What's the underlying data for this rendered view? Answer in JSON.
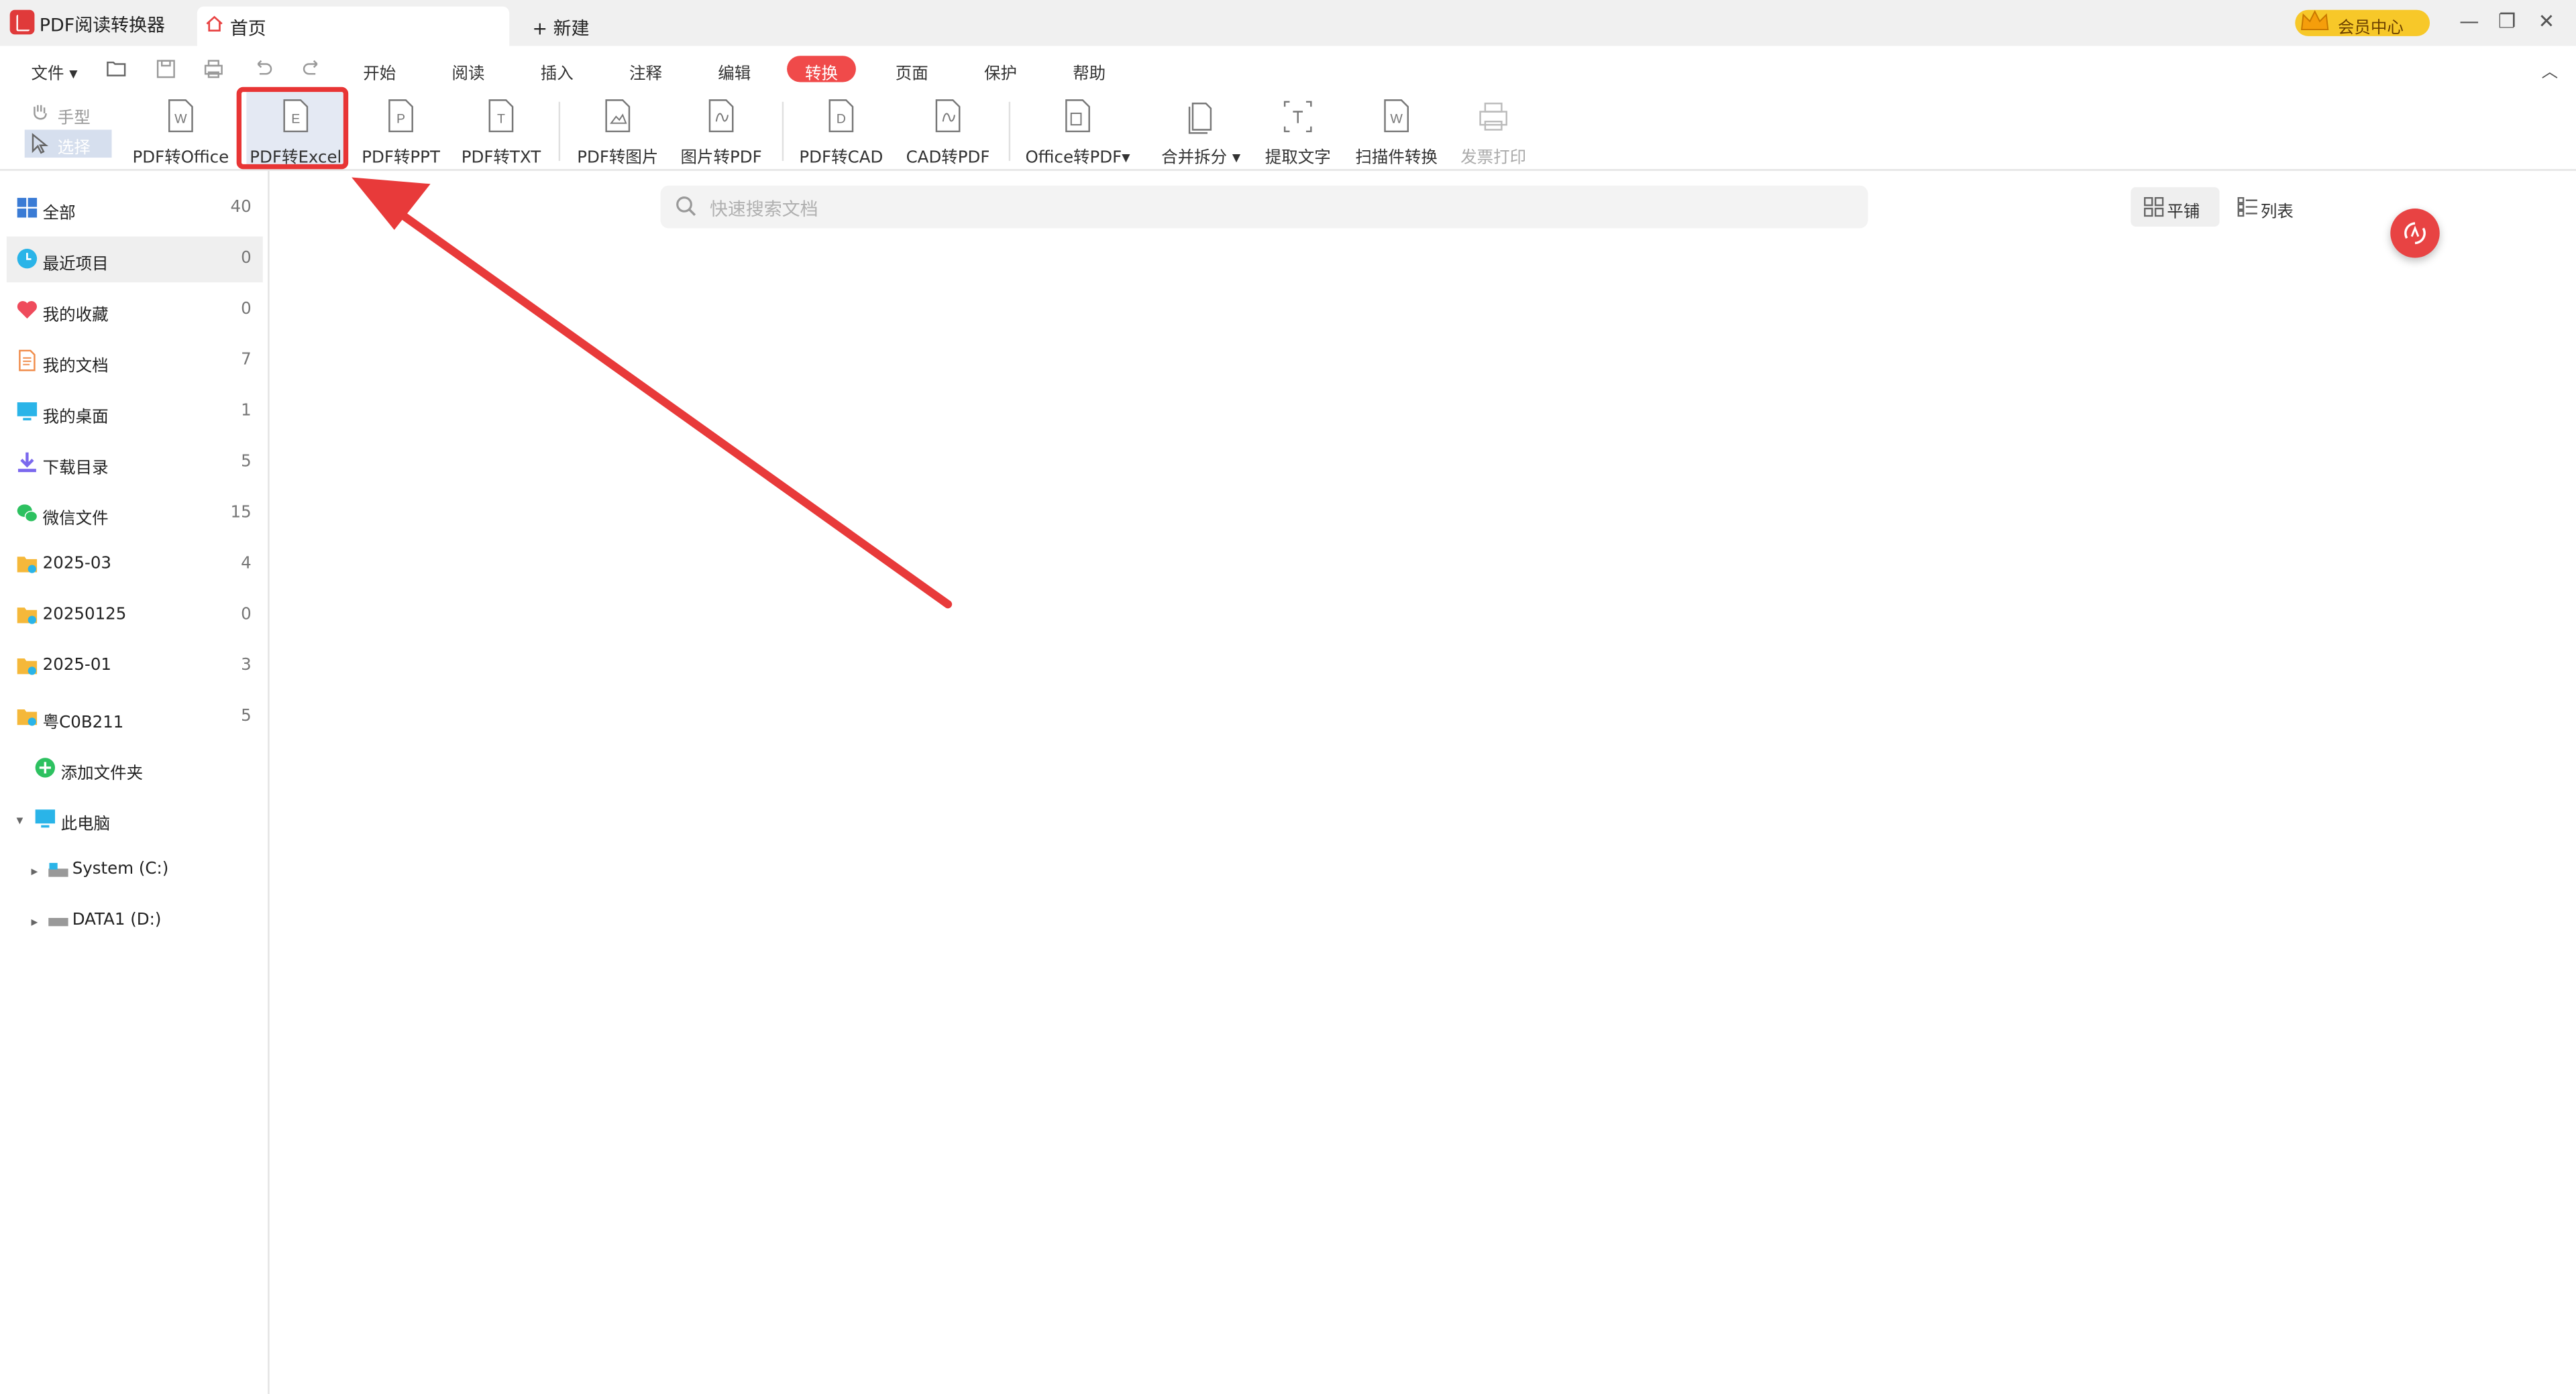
{
  "titlebar": {
    "app_title": "PDF阅读转换器",
    "home_tab": "首页",
    "new_tab": "新建",
    "vip_label": "会员中心",
    "window_controls": [
      "minimize-icon",
      "restore-icon",
      "close-icon"
    ]
  },
  "menu": {
    "file": "文件",
    "tabs": [
      "开始",
      "阅读",
      "插入",
      "注释",
      "编辑",
      "转换",
      "页面",
      "保护",
      "帮助"
    ],
    "active_tab": "转换"
  },
  "toolbar": {
    "hand": "手型",
    "select": "选择",
    "tools": [
      {
        "label": "PDF转Office",
        "icon": "pdf-to-office-icon"
      },
      {
        "label": "PDF转Excel",
        "icon": "pdf-to-excel-icon"
      },
      {
        "label": "PDF转PPT",
        "icon": "pdf-to-ppt-icon"
      },
      {
        "label": "PDF转TXT",
        "icon": "pdf-to-txt-icon"
      },
      {
        "label": "PDF转图片",
        "icon": "pdf-to-image-icon"
      },
      {
        "label": "图片转PDF",
        "icon": "image-to-pdf-icon"
      },
      {
        "label": "PDF转CAD",
        "icon": "pdf-to-cad-icon"
      },
      {
        "label": "CAD转PDF",
        "icon": "cad-to-pdf-icon"
      },
      {
        "label": "Office转PDF",
        "icon": "office-to-pdf-icon"
      },
      {
        "label": "合并拆分",
        "icon": "merge-split-icon"
      },
      {
        "label": "提取文字",
        "icon": "extract-text-icon"
      },
      {
        "label": "扫描件转换",
        "icon": "scan-convert-icon"
      },
      {
        "label": "发票打印",
        "icon": "invoice-print-icon"
      }
    ],
    "highlighted": "PDF转Excel",
    "annotation_color": "#e83535"
  },
  "sidebar": {
    "items": [
      {
        "label": "全部",
        "count": "40"
      },
      {
        "label": "最近项目",
        "count": "0"
      },
      {
        "label": "我的收藏",
        "count": "0"
      },
      {
        "label": "我的文档",
        "count": "7"
      },
      {
        "label": "我的桌面",
        "count": "1"
      },
      {
        "label": "下载目录",
        "count": "5"
      },
      {
        "label": "微信文件",
        "count": "15"
      },
      {
        "label": "2025-03",
        "count": "4"
      },
      {
        "label": "20250125",
        "count": "0"
      },
      {
        "label": "2025-01",
        "count": "3"
      },
      {
        "label": "粤C0B211",
        "count": "5"
      }
    ],
    "add_folder": "添加文件夹",
    "this_pc": "此电脑",
    "drives": [
      "System (C:)",
      "DATA1 (D:)"
    ]
  },
  "main": {
    "search_placeholder": "快速搜索文档",
    "view_grid": "平铺",
    "view_list": "列表"
  },
  "colors": {
    "accent": "#f04a4a",
    "vip": "#f7c829",
    "selected_bg": "#e4e9f3"
  }
}
